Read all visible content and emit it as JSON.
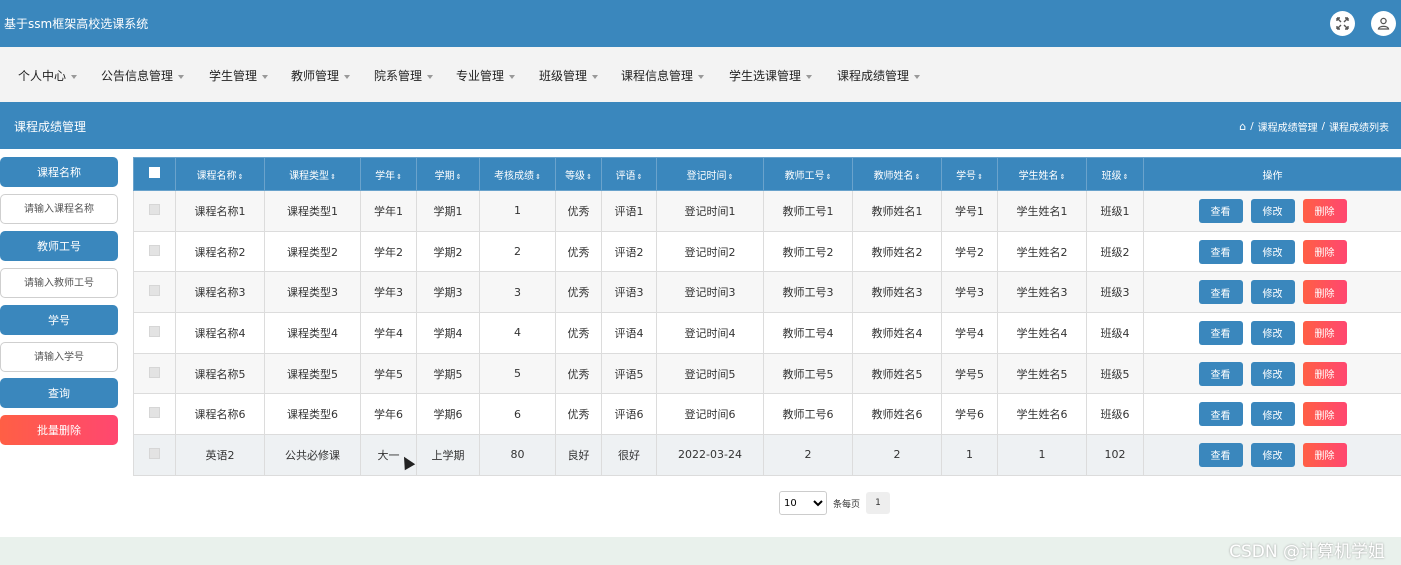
{
  "header": {
    "app_title": "基于ssm框架高校选课系统",
    "expand_icon": "expand-icon",
    "user_icon": "user-icon"
  },
  "nav": {
    "items": [
      {
        "label": "个人中心"
      },
      {
        "label": "公告信息管理"
      },
      {
        "label": "学生管理"
      },
      {
        "label": "教师管理"
      },
      {
        "label": "院系管理"
      },
      {
        "label": "专业管理"
      },
      {
        "label": "班级管理"
      },
      {
        "label": "课程信息管理"
      },
      {
        "label": "学生选课管理"
      },
      {
        "label": "课程成绩管理"
      }
    ]
  },
  "page": {
    "title": "课程成绩管理",
    "breadcrumb": [
      "课程成绩管理",
      "课程成绩列表"
    ],
    "breadcrumb_sep": "/"
  },
  "search": {
    "course_name_label": "课程名称",
    "course_name_placeholder": "请输入课程名称",
    "teacher_no_label": "教师工号",
    "teacher_no_placeholder": "请输入教师工号",
    "student_no_label": "学号",
    "student_no_placeholder": "请输入学号",
    "query_label": "查询",
    "bulk_delete_label": "批量删除"
  },
  "table": {
    "columns": [
      "课程名称",
      "课程类型",
      "学年",
      "学期",
      "考核成绩",
      "等级",
      "评语",
      "登记时间",
      "教师工号",
      "教师姓名",
      "学号",
      "学生姓名",
      "班级",
      "操作"
    ],
    "sort_glyph": "⇕",
    "rows": [
      [
        "课程名称1",
        "课程类型1",
        "学年1",
        "学期1",
        "1",
        "优秀",
        "评语1",
        "登记时间1",
        "教师工号1",
        "教师姓名1",
        "学号1",
        "学生姓名1",
        "班级1"
      ],
      [
        "课程名称2",
        "课程类型2",
        "学年2",
        "学期2",
        "2",
        "优秀",
        "评语2",
        "登记时间2",
        "教师工号2",
        "教师姓名2",
        "学号2",
        "学生姓名2",
        "班级2"
      ],
      [
        "课程名称3",
        "课程类型3",
        "学年3",
        "学期3",
        "3",
        "优秀",
        "评语3",
        "登记时间3",
        "教师工号3",
        "教师姓名3",
        "学号3",
        "学生姓名3",
        "班级3"
      ],
      [
        "课程名称4",
        "课程类型4",
        "学年4",
        "学期4",
        "4",
        "优秀",
        "评语4",
        "登记时间4",
        "教师工号4",
        "教师姓名4",
        "学号4",
        "学生姓名4",
        "班级4"
      ],
      [
        "课程名称5",
        "课程类型5",
        "学年5",
        "学期5",
        "5",
        "优秀",
        "评语5",
        "登记时间5",
        "教师工号5",
        "教师姓名5",
        "学号5",
        "学生姓名5",
        "班级5"
      ],
      [
        "课程名称6",
        "课程类型6",
        "学年6",
        "学期6",
        "6",
        "优秀",
        "评语6",
        "登记时间6",
        "教师工号6",
        "教师姓名6",
        "学号6",
        "学生姓名6",
        "班级6"
      ],
      [
        "英语2",
        "公共必修课",
        "大一",
        "上学期",
        "80",
        "良好",
        "很好",
        "2022-03-24",
        "2",
        "2",
        "1",
        "1",
        "102"
      ]
    ],
    "actions": {
      "view": "查看",
      "edit": "修改",
      "delete": "删除"
    }
  },
  "pager": {
    "page_size": "10",
    "page_size_suffix": "条每页",
    "current_page": "1"
  },
  "watermark": "CSDN @计算机学姐",
  "colors": {
    "primary": "#3a87bd",
    "danger": "#ff5252",
    "nav_bg": "#f3f3f3"
  }
}
